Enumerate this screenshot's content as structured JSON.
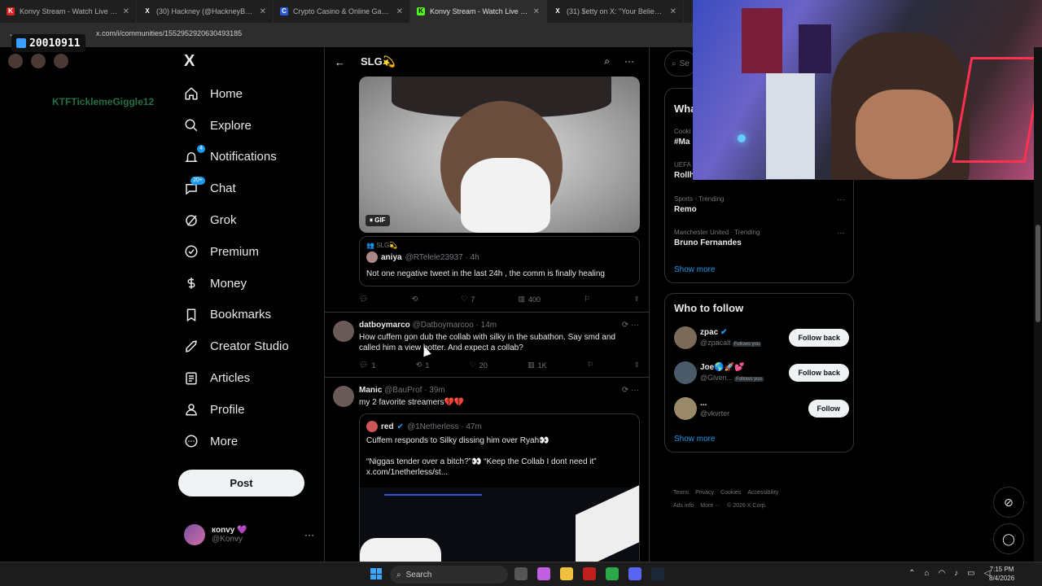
{
  "browser": {
    "tabs": [
      {
        "label": "Konvy Stream - Watch Live on",
        "color": "#e02020",
        "favicon": "K"
      },
      {
        "label": "(30) Hackney (@HackneyBurbe",
        "color": "#222",
        "favicon": "X"
      },
      {
        "label": "Crypto Casino & Online Gamb",
        "color": "#2a5bd7",
        "favicon": "C"
      },
      {
        "label": "Konvy Stream - Watch Live on",
        "color": "#53fc18",
        "favicon": "K"
      },
      {
        "label": "(31) $etty on X: \"Your Believing",
        "color": "#222",
        "favicon": "X"
      }
    ],
    "url": "x.com/i/communities/1552952920630493185"
  },
  "overlay": {
    "score": "20010911",
    "username": "KTFTicklemeGiggle12"
  },
  "sidebar": {
    "logo": "X",
    "items": [
      {
        "label": "Home",
        "icon": "home-icon"
      },
      {
        "label": "Explore",
        "icon": "search-icon"
      },
      {
        "label": "Notifications",
        "icon": "bell-icon",
        "badge": "4"
      },
      {
        "label": "Chat",
        "icon": "chat-icon",
        "badge": "20+"
      },
      {
        "label": "Grok",
        "icon": "grok-icon"
      },
      {
        "label": "Premium",
        "icon": "premium-icon"
      },
      {
        "label": "Money",
        "icon": "money-icon"
      },
      {
        "label": "Bookmarks",
        "icon": "bookmark-icon"
      },
      {
        "label": "Creator Studio",
        "icon": "rocket-icon"
      },
      {
        "label": "Articles",
        "icon": "articles-icon"
      },
      {
        "label": "Profile",
        "icon": "person-icon"
      },
      {
        "label": "More",
        "icon": "more-icon"
      }
    ],
    "post_label": "Post",
    "account": {
      "name": "кonvy 💜",
      "handle": "@Konvy"
    }
  },
  "feed": {
    "back": "←",
    "title": "SLG💫",
    "gif_label": "GIF",
    "quote1": {
      "community": "SLG💫",
      "name": "aniya",
      "handle": "@RTelele23937 · 4h",
      "text": "Not one negative tweet in the last 24h , the comm is finally healing"
    },
    "actions1": {
      "replies": "",
      "reposts": "",
      "likes": "7",
      "views": "400"
    },
    "post2": {
      "name": "datboymarco",
      "handle": "@Datboymarcoo · 14m",
      "text": "How cuffem gon dub the collab with silky in the subathon. Say smd and called him a view botter. And expect a collab?",
      "replies": "1",
      "reposts": "1",
      "likes": "20",
      "views": "1K"
    },
    "post3": {
      "name": "Manic",
      "handle": "@BauProf · 39m",
      "text": "my 2 favorite streamers💔💔"
    },
    "quote2": {
      "name": "red",
      "handle": "@1Netherless · 47m",
      "text": "Cuffem responds to Silky dissing him over Ryah👀\n\n“Niggas tender over a bitch?”👀 “Keep the Collab I dont need it”\nx.com/1netherless/st..."
    }
  },
  "right": {
    "search_placeholder": "Se",
    "trends_title": "Wha",
    "trends": [
      {
        "meta": "Cooki",
        "name": "#Ma"
      },
      {
        "meta": "UEFA",
        "name": "Rollh"
      },
      {
        "meta": "Sports · Trending",
        "name": "Remo"
      },
      {
        "meta": "Manchester United · Trending",
        "name": "Bruno Fernandes"
      }
    ],
    "show_more": "Show more",
    "wtf_title": "Who to follow",
    "follows": [
      {
        "name": "zpac",
        "handle": "@zpacalt",
        "follows_you": "Follows you",
        "button": "Follow back"
      },
      {
        "name": "Joe🌎🚀💕",
        "handle": "@Glven...",
        "follows_you": "Follows you",
        "button": "Follow back"
      },
      {
        "name": "...",
        "handle": "@vkvrter",
        "follows_you": "",
        "button": "Follow"
      }
    ],
    "footer": [
      "Terms",
      "Privacy",
      "Cookies",
      "Accessibility",
      "Ads info",
      "More ···",
      "© 2026 X Corp."
    ]
  },
  "taskbar": {
    "search": "Search",
    "time": "7:15 PM",
    "date": "8/4/2026"
  },
  "colors": {
    "accent": "#1d9bf0",
    "bg": "#000000",
    "border": "#2f3336"
  }
}
